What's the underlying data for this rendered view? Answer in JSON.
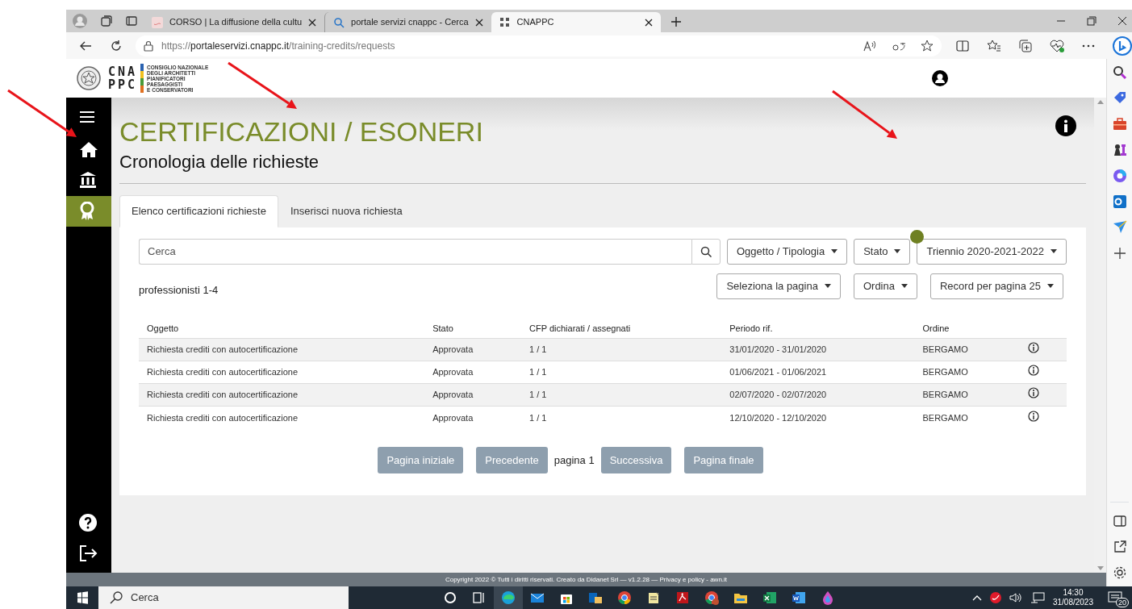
{
  "browser": {
    "tabs": [
      {
        "kind": "course",
        "title": "CORSO | La diffusione della cultu",
        "selected": false
      },
      {
        "kind": "search",
        "title": "portale servizi cnappc - Cerca",
        "selected": false
      },
      {
        "kind": "logo",
        "title": "CNAPPC",
        "selected": true
      }
    ],
    "url_scheme": "https://",
    "url_host": "portaleservizi.cnappc.it",
    "url_path": "/training-credits/requests"
  },
  "header": {
    "logo_top": "CNA",
    "logo_bottom": "PPC",
    "org_lines": [
      "CONSIGLIO NAZIONALE",
      "DEGLI ARCHITETTI",
      "PIANIFICATORI",
      "PAESAGGISTI",
      "E CONSERVATORI"
    ]
  },
  "sidebar": {
    "items": [
      {
        "kind": "menu",
        "selected": false
      },
      {
        "kind": "home",
        "selected": false
      },
      {
        "kind": "institution",
        "selected": false
      },
      {
        "kind": "award",
        "selected": true
      }
    ],
    "bottom": [
      {
        "kind": "help"
      },
      {
        "kind": "logout"
      }
    ]
  },
  "page": {
    "title": "CERTIFICAZIONI / ESONERI",
    "subtitle": "Cronologia delle richieste",
    "tabs": [
      {
        "label": "Elenco certificazioni richieste",
        "selected": true
      },
      {
        "label": "Inserisci nuova richiesta",
        "selected": false
      }
    ],
    "search": {
      "placeholder": "Cerca"
    },
    "filters": [
      {
        "label": "Oggetto / Tipologia",
        "marked": false
      },
      {
        "label": "Stato",
        "marked": false
      },
      {
        "label": "Triennio 2020-2021-2022",
        "marked": true
      }
    ],
    "count": "professionisti 1-4",
    "controls": [
      "Seleziona la pagina",
      "Ordina",
      "Record per pagina 25"
    ],
    "table": {
      "columns": [
        "Oggetto",
        "Stato",
        "CFP dichiarati / assegnati",
        "Periodo rif.",
        "Ordine"
      ],
      "rows": [
        [
          "Richiesta crediti con autocertificazione",
          "Approvata",
          "1 / 1",
          "31/01/2020 - 31/01/2020",
          "BERGAMO"
        ],
        [
          "Richiesta crediti con autocertificazione",
          "Approvata",
          "1 / 1",
          "01/06/2021 - 01/06/2021",
          "BERGAMO"
        ],
        [
          "Richiesta crediti con autocertificazione",
          "Approvata",
          "1 / 1",
          "02/07/2020 - 02/07/2020",
          "BERGAMO"
        ],
        [
          "Richiesta crediti con autocertificazione",
          "Approvata",
          "1 / 1",
          "12/10/2020 - 12/10/2020",
          "BERGAMO"
        ]
      ]
    },
    "pagination": {
      "first": "Pagina iniziale",
      "prev": "Precedente",
      "current": "pagina 1",
      "next": "Successiva",
      "last": "Pagina finale"
    }
  },
  "footer": {
    "text": "Copyright 2022 © Tutti i diritti riservati. Creato da Didanet Srl — v1.2.28 — ",
    "link1": "Privacy e policy",
    "sep": " - ",
    "link2": "awn.it"
  },
  "taskbar": {
    "search": "Cerca",
    "time": "14:30",
    "date": "31/08/2023",
    "notifications": "20"
  }
}
